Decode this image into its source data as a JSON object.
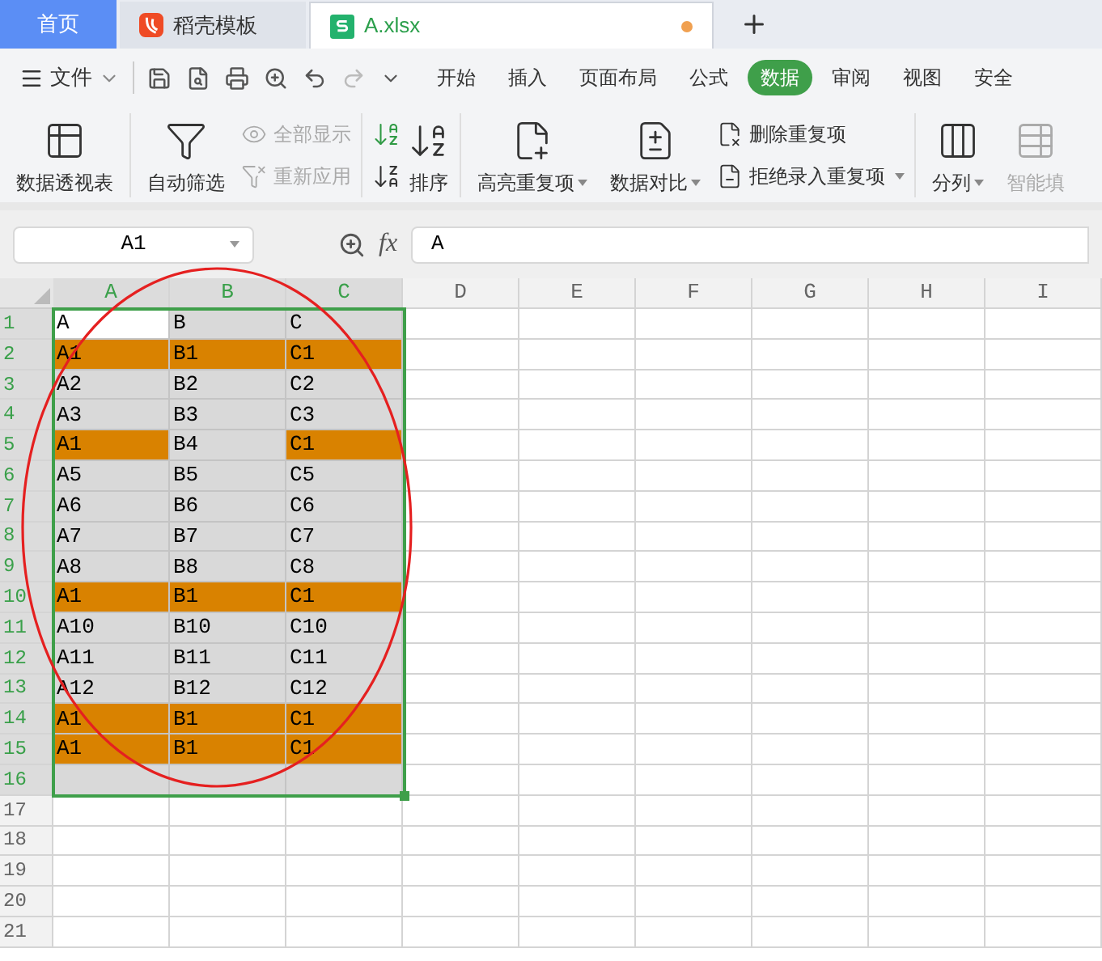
{
  "tabs": [
    {
      "label": "首页",
      "kind": "home",
      "selected": false
    },
    {
      "label": "稻壳模板",
      "kind": "template",
      "selected": false
    },
    {
      "label": "A.xlsx",
      "kind": "sheet",
      "selected": true,
      "unsaved": true
    }
  ],
  "menu": {
    "file": "文件",
    "tabs": [
      {
        "label": "开始",
        "selected": false
      },
      {
        "label": "插入",
        "selected": false
      },
      {
        "label": "页面布局",
        "selected": false
      },
      {
        "label": "公式",
        "selected": false
      },
      {
        "label": "数据",
        "selected": true
      },
      {
        "label": "审阅",
        "selected": false
      },
      {
        "label": "视图",
        "selected": false
      },
      {
        "label": "安全",
        "selected": false
      }
    ]
  },
  "ribbon": [
    {
      "label": "数据透视表",
      "kind": "large",
      "disabled": false,
      "dropdown": false
    },
    {
      "kind": "sep"
    },
    {
      "label": "自动筛选",
      "kind": "large",
      "disabled": false,
      "dropdown": false
    },
    {
      "kind": "stack",
      "items": [
        {
          "label": "全部显示",
          "disabled": true,
          "dropdown": false
        },
        {
          "label": "重新应用",
          "disabled": true,
          "dropdown": false
        }
      ]
    },
    {
      "kind": "sep"
    },
    {
      "kind": "sort",
      "label": "排序"
    },
    {
      "kind": "sep"
    },
    {
      "label": "高亮重复项",
      "kind": "large",
      "disabled": false,
      "dropdown": true
    },
    {
      "label": "数据对比",
      "kind": "large",
      "disabled": false,
      "dropdown": true
    },
    {
      "kind": "stack",
      "items": [
        {
          "label": "删除重复项",
          "disabled": false,
          "dropdown": false
        },
        {
          "label": "拒绝录入重复项",
          "disabled": false,
          "dropdown": true
        }
      ]
    },
    {
      "kind": "sep"
    },
    {
      "label": "分列",
      "kind": "large",
      "disabled": false,
      "dropdown": true
    },
    {
      "label": "智能填",
      "kind": "large",
      "disabled": true,
      "dropdown": false
    }
  ],
  "formula_bar": {
    "name_box": "A1",
    "fx": "fx",
    "value": "A"
  },
  "columns": [
    {
      "label": "A",
      "selected": true
    },
    {
      "label": "B",
      "selected": true
    },
    {
      "label": "C",
      "selected": true
    },
    {
      "label": "D",
      "selected": false
    },
    {
      "label": "E",
      "selected": false
    },
    {
      "label": "F",
      "selected": false
    },
    {
      "label": "G",
      "selected": false
    },
    {
      "label": "H",
      "selected": false
    },
    {
      "label": "I",
      "selected": false
    }
  ],
  "rows": [
    {
      "label": "1",
      "selected": true,
      "cells": [
        {
          "text": "A",
          "kind": "active"
        },
        {
          "text": "B",
          "kind": "plain"
        },
        {
          "text": "C",
          "kind": "plain"
        }
      ]
    },
    {
      "label": "2",
      "selected": true,
      "cells": [
        {
          "text": "A1",
          "kind": "duplicate"
        },
        {
          "text": "B1",
          "kind": "duplicate"
        },
        {
          "text": "C1",
          "kind": "duplicate"
        }
      ]
    },
    {
      "label": "3",
      "selected": true,
      "cells": [
        {
          "text": "A2",
          "kind": "plain"
        },
        {
          "text": "B2",
          "kind": "plain"
        },
        {
          "text": "C2",
          "kind": "plain"
        }
      ]
    },
    {
      "label": "4",
      "selected": true,
      "cells": [
        {
          "text": "A3",
          "kind": "plain"
        },
        {
          "text": "B3",
          "kind": "plain"
        },
        {
          "text": "C3",
          "kind": "plain"
        }
      ]
    },
    {
      "label": "5",
      "selected": true,
      "cells": [
        {
          "text": "A1",
          "kind": "duplicate"
        },
        {
          "text": "B4",
          "kind": "plain"
        },
        {
          "text": "C1",
          "kind": "duplicate"
        }
      ]
    },
    {
      "label": "6",
      "selected": true,
      "cells": [
        {
          "text": "A5",
          "kind": "plain"
        },
        {
          "text": "B5",
          "kind": "plain"
        },
        {
          "text": "C5",
          "kind": "plain"
        }
      ]
    },
    {
      "label": "7",
      "selected": true,
      "cells": [
        {
          "text": "A6",
          "kind": "plain"
        },
        {
          "text": "B6",
          "kind": "plain"
        },
        {
          "text": "C6",
          "kind": "plain"
        }
      ]
    },
    {
      "label": "8",
      "selected": true,
      "cells": [
        {
          "text": "A7",
          "kind": "plain"
        },
        {
          "text": "B7",
          "kind": "plain"
        },
        {
          "text": "C7",
          "kind": "plain"
        }
      ]
    },
    {
      "label": "9",
      "selected": true,
      "cells": [
        {
          "text": "A8",
          "kind": "plain"
        },
        {
          "text": "B8",
          "kind": "plain"
        },
        {
          "text": "C8",
          "kind": "plain"
        }
      ]
    },
    {
      "label": "10",
      "selected": true,
      "cells": [
        {
          "text": "A1",
          "kind": "duplicate"
        },
        {
          "text": "B1",
          "kind": "duplicate"
        },
        {
          "text": "C1",
          "kind": "duplicate"
        }
      ]
    },
    {
      "label": "11",
      "selected": true,
      "cells": [
        {
          "text": "A10",
          "kind": "plain"
        },
        {
          "text": "B10",
          "kind": "plain"
        },
        {
          "text": "C10",
          "kind": "plain"
        }
      ]
    },
    {
      "label": "12",
      "selected": true,
      "cells": [
        {
          "text": "A11",
          "kind": "plain"
        },
        {
          "text": "B11",
          "kind": "plain"
        },
        {
          "text": "C11",
          "kind": "plain"
        }
      ]
    },
    {
      "label": "13",
      "selected": true,
      "cells": [
        {
          "text": "A12",
          "kind": "plain"
        },
        {
          "text": "B12",
          "kind": "plain"
        },
        {
          "text": "C12",
          "kind": "plain"
        }
      ]
    },
    {
      "label": "14",
      "selected": true,
      "cells": [
        {
          "text": "A1",
          "kind": "duplicate"
        },
        {
          "text": "B1",
          "kind": "duplicate"
        },
        {
          "text": "C1",
          "kind": "duplicate"
        }
      ]
    },
    {
      "label": "15",
      "selected": true,
      "cells": [
        {
          "text": "A1",
          "kind": "duplicate"
        },
        {
          "text": "B1",
          "kind": "duplicate"
        },
        {
          "text": "C1",
          "kind": "duplicate"
        }
      ]
    },
    {
      "label": "16",
      "selected": true,
      "cells": [
        {
          "kind": "plain"
        },
        {
          "kind": "plain"
        },
        {
          "kind": "plain"
        }
      ]
    },
    {
      "label": "17",
      "selected": false,
      "cells": []
    },
    {
      "label": "18",
      "selected": false,
      "cells": []
    },
    {
      "label": "19",
      "selected": false,
      "cells": []
    },
    {
      "label": "20",
      "selected": false,
      "cells": []
    },
    {
      "label": "21",
      "selected": false,
      "cells": []
    }
  ]
}
